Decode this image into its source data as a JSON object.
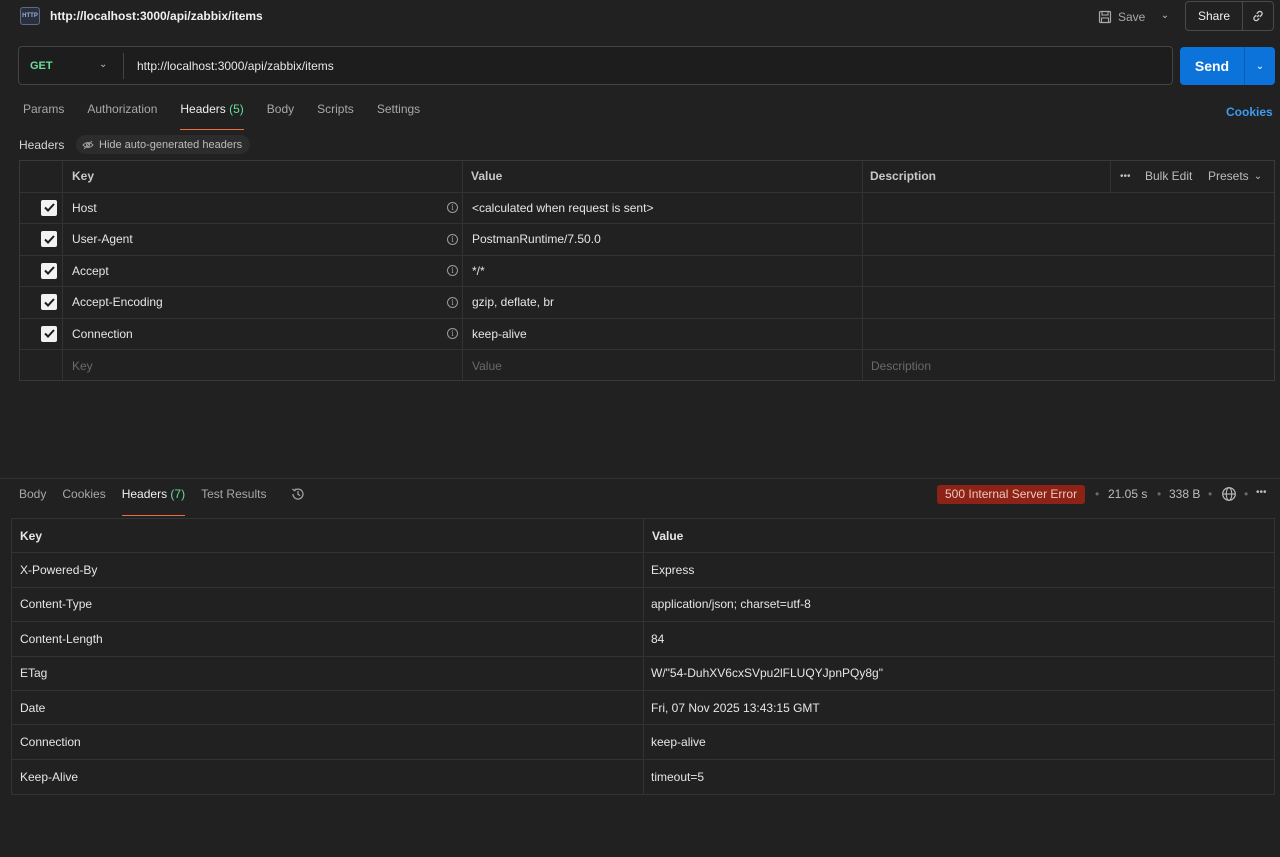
{
  "request": {
    "icon_label": "HTTP",
    "title": "http://localhost:3000/api/zabbix/items",
    "save_label": "Save",
    "share_label": "Share",
    "method": "GET",
    "url": "http://localhost:3000/api/zabbix/items",
    "send_label": "Send"
  },
  "request_tabs": [
    {
      "label": "Params",
      "count": ""
    },
    {
      "label": "Authorization",
      "count": ""
    },
    {
      "label": "Headers",
      "count": "(5)"
    },
    {
      "label": "Body",
      "count": ""
    },
    {
      "label": "Scripts",
      "count": ""
    },
    {
      "label": "Settings",
      "count": ""
    }
  ],
  "cookies_label": "Cookies",
  "headers_section": {
    "label": "Headers",
    "hide_auto_label": "Hide auto-generated headers",
    "columns": {
      "key": "Key",
      "value": "Value",
      "description": "Description"
    },
    "bulk_edit_label": "Bulk Edit",
    "presets_label": "Presets",
    "rows": [
      {
        "key": "Host",
        "value": "<calculated when request is sent>",
        "checked": true
      },
      {
        "key": "User-Agent",
        "value": "PostmanRuntime/7.50.0",
        "checked": true
      },
      {
        "key": "Accept",
        "value": "*/*",
        "checked": true
      },
      {
        "key": "Accept-Encoding",
        "value": "gzip, deflate, br",
        "checked": true
      },
      {
        "key": "Connection",
        "value": "keep-alive",
        "checked": true
      }
    ],
    "placeholders": {
      "key": "Key",
      "value": "Value",
      "description": "Description"
    }
  },
  "response": {
    "tabs": [
      {
        "label": "Body",
        "count": ""
      },
      {
        "label": "Cookies",
        "count": ""
      },
      {
        "label": "Headers",
        "count": "(7)"
      },
      {
        "label": "Test Results",
        "count": ""
      }
    ],
    "status": "500 Internal Server Error",
    "time": "21.05 s",
    "size": "338 B",
    "columns": {
      "key": "Key",
      "value": "Value"
    },
    "headers": [
      {
        "key": "X-Powered-By",
        "value": "Express"
      },
      {
        "key": "Content-Type",
        "value": "application/json; charset=utf-8"
      },
      {
        "key": "Content-Length",
        "value": "84"
      },
      {
        "key": "ETag",
        "value": "W/\"54-DuhXV6cxSVpu2lFLUQYJpnPQy8g\""
      },
      {
        "key": "Date",
        "value": "Fri, 07 Nov 2025 13:43:15 GMT"
      },
      {
        "key": "Connection",
        "value": "keep-alive"
      },
      {
        "key": "Keep-Alive",
        "value": "timeout=5"
      }
    ]
  },
  "colors": {
    "background": "#212121",
    "accent_blue": "#0b73da",
    "method_green": "#6bdd9a",
    "tab_underline": "#f26b3a",
    "error_badge": "#8c2316"
  }
}
